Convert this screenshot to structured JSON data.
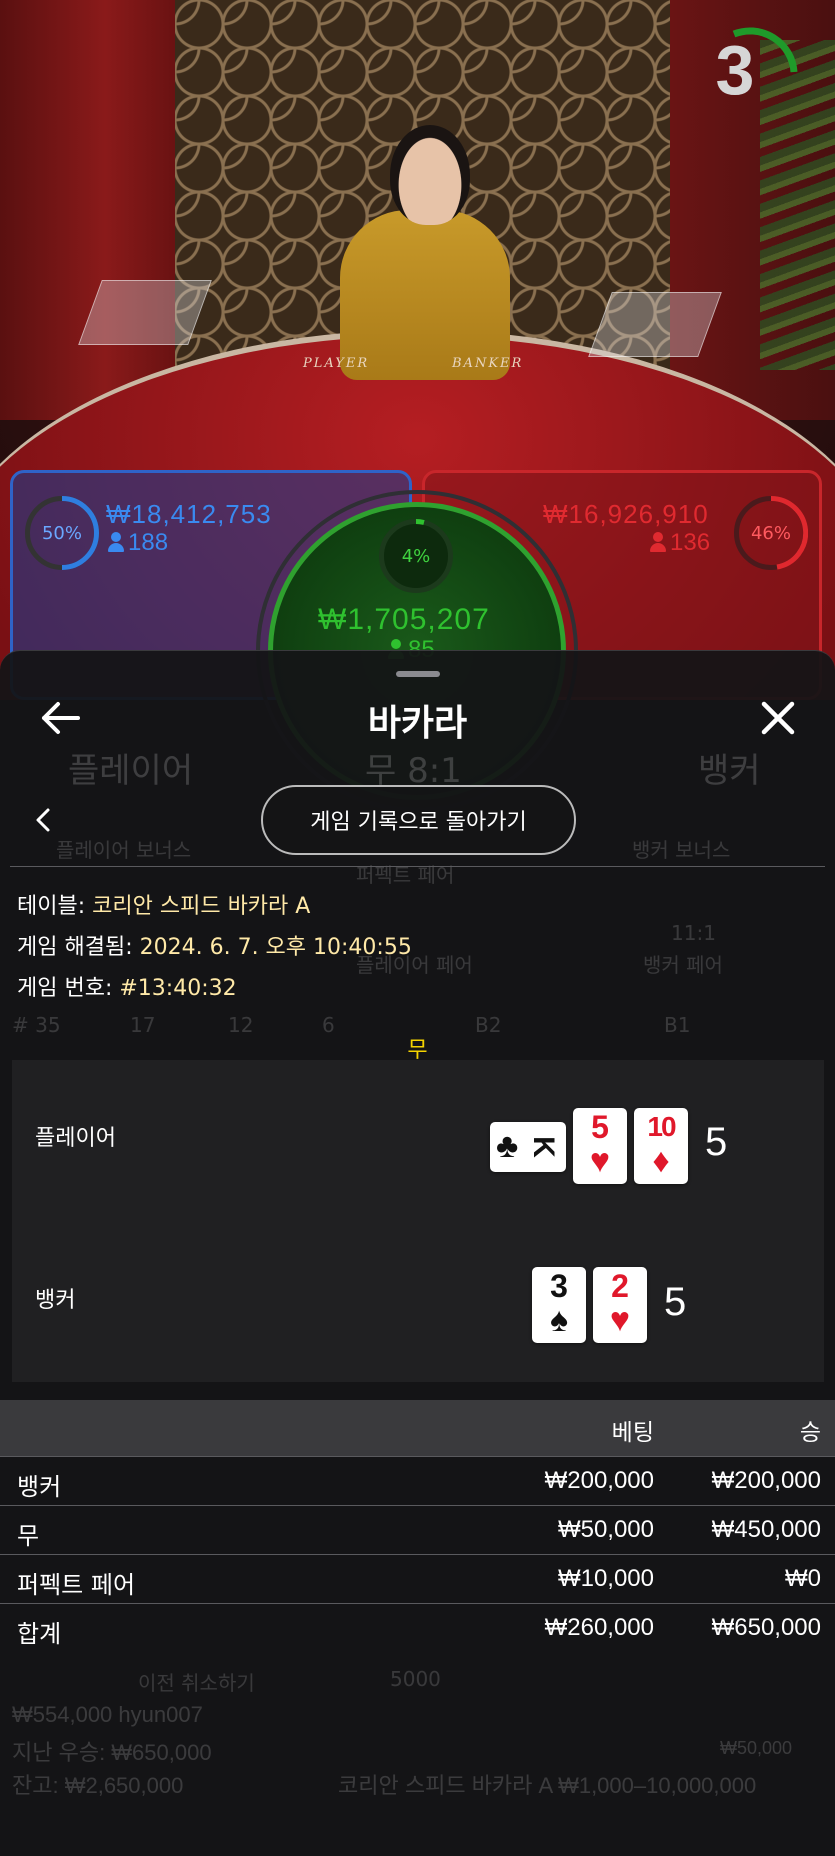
{
  "stream": {
    "felt_player": "PLAYER",
    "felt_banker": "BANKER",
    "timer": "3"
  },
  "spots": {
    "player": {
      "pct": "50%",
      "amount": "₩18,412,753",
      "players": "188",
      "pct_value": 0.5
    },
    "banker": {
      "pct": "46%",
      "amount": "₩16,926,910",
      "players": "136",
      "pct_value": 0.46
    },
    "tie": {
      "pct": "4%",
      "amount": "₩1,705,207",
      "players": "85",
      "pct_value": 0.04
    }
  },
  "background_ui": {
    "player": "플레이어",
    "tie": "무 8:1",
    "banker": "뱅커",
    "player_bonus": "플레이어 보너스",
    "perfect_pair": "퍼펙트 페어",
    "banker_bonus": "뱅커 보너스",
    "player_pair": "플레이어 페어",
    "banker_pair_odds": "11:1",
    "banker_pair": "뱅커 페어",
    "stats": [
      "# 35",
      "17",
      "12",
      "6",
      "B2",
      "B1"
    ],
    "undo": "이전 취소하기",
    "chip": "5000",
    "footer_left_1": "₩554,000 hyun007",
    "footer_left_2": "지난 우승: ₩650,000",
    "footer_left_3": "잔고: ₩2,650,000",
    "footer_right_1": "₩50,000",
    "footer_right_2": "코리안 스피드 바카라 A  ₩1,000–10,000,000"
  },
  "sheet": {
    "title": "바카라",
    "return_button": "게임 기록으로 돌아가기",
    "table_label": "테이블: ",
    "table_value": "코리안 스피드 바카라 A",
    "settled_label": "게임 해결됨: ",
    "settled_value": "2024. 6. 7. 오후 10:40:55",
    "game_no_label": "게임 번호: ",
    "game_no_value": "#13:40:32",
    "result": "무",
    "player_label": "플레이어",
    "banker_label": "뱅커",
    "player_score": "5",
    "banker_score": "5",
    "player_cards": [
      {
        "rank": "K",
        "suit": "♣",
        "color": "#111111",
        "rotated": true
      },
      {
        "rank": "5",
        "suit": "♥",
        "color": "#e0182b",
        "rotated": false
      },
      {
        "rank": "10",
        "suit": "♦",
        "color": "#e0182b",
        "rotated": false
      }
    ],
    "banker_cards": [
      {
        "rank": "3",
        "suit": "♠",
        "color": "#111111",
        "rotated": false
      },
      {
        "rank": "2",
        "suit": "♥",
        "color": "#e0182b",
        "rotated": false
      }
    ],
    "bets_header": {
      "bet": "베팅",
      "win": "승"
    },
    "bets": [
      {
        "name": "뱅커",
        "bet": "₩200,000",
        "win": "₩200,000"
      },
      {
        "name": "무",
        "bet": "₩50,000",
        "win": "₩450,000"
      },
      {
        "name": "퍼펙트 페어",
        "bet": "₩10,000",
        "win": "₩0"
      }
    ],
    "total": {
      "name": "합계",
      "bet": "₩260,000",
      "win": "₩650,000"
    }
  },
  "colors": {
    "player_blue": "#2f7ee0",
    "banker_red": "#e0282e",
    "tie_green": "#2fc12f",
    "result_yellow": "#f5d300"
  }
}
